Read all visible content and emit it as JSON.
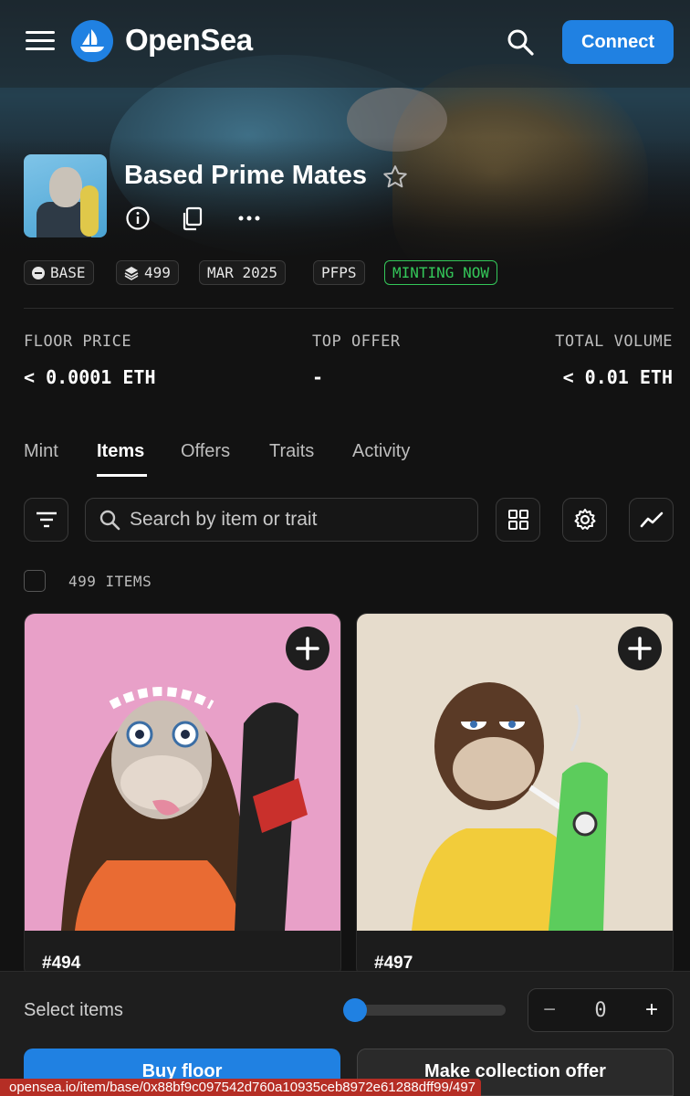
{
  "header": {
    "logo_text": "OpenSea",
    "connect_label": "Connect"
  },
  "collection": {
    "name": "Based Prime Mates",
    "chips": [
      "BASE",
      "499",
      "MAR 2025",
      "PFPS",
      "MINTING NOW"
    ]
  },
  "stats": [
    {
      "label": "FLOOR PRICE",
      "value": "< 0.0001 ETH"
    },
    {
      "label": "TOP OFFER",
      "value": "-"
    },
    {
      "label": "TOTAL VOLUME",
      "value": "< 0.01 ETH"
    }
  ],
  "tabs": [
    {
      "label": "Mint",
      "active": false
    },
    {
      "label": "Items",
      "active": true
    },
    {
      "label": "Offers",
      "active": false
    },
    {
      "label": "Traits",
      "active": false
    },
    {
      "label": "Activity",
      "active": false
    }
  ],
  "toolbar": {
    "search_placeholder": "Search by item or trait"
  },
  "items_count": "499 ITEMS",
  "cards": [
    {
      "name": "#494",
      "background": "#e8a0c8"
    },
    {
      "name": "#497",
      "background": "#e6dccc"
    }
  ],
  "bottom": {
    "select_label": "Select items",
    "slider_value": 0,
    "quantity": "0",
    "buy_label": "Buy floor",
    "offer_label": "Make collection offer"
  },
  "status_url": "opensea.io/item/base/0x88bf9c097542d760a10935ceb8972e61288dff99/497",
  "colors": {
    "accent": "#2081e2",
    "minting": "#34c759",
    "background": "#121212"
  }
}
